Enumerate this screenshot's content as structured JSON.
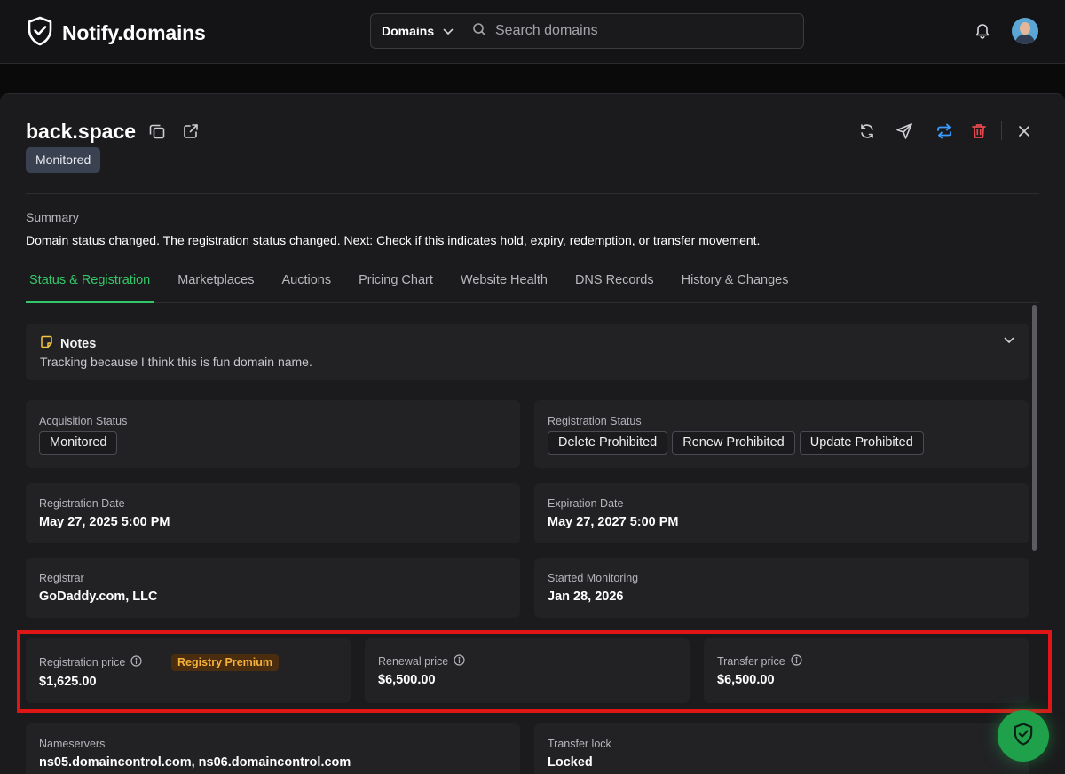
{
  "app": {
    "name": "Notify.domains"
  },
  "search": {
    "scope": "Domains",
    "placeholder": "Search domains"
  },
  "domain": {
    "name": "back.space",
    "status": "Monitored",
    "summary_label": "Summary",
    "summary_text": "Domain status changed. The registration status changed. Next: Check if this indicates hold, expiry, redemption, or transfer movement."
  },
  "tabs": [
    {
      "label": "Status & Registration",
      "active": true
    },
    {
      "label": "Marketplaces"
    },
    {
      "label": "Auctions"
    },
    {
      "label": "Pricing Chart"
    },
    {
      "label": "Website Health"
    },
    {
      "label": "DNS Records"
    },
    {
      "label": "History & Changes"
    }
  ],
  "notes": {
    "title": "Notes",
    "text": "Tracking because I think this is fun domain name."
  },
  "fields": {
    "acquisition_status": {
      "label": "Acquisition Status",
      "value": "Monitored"
    },
    "registration_status": {
      "label": "Registration Status",
      "values": [
        "Delete Prohibited",
        "Renew Prohibited",
        "Update Prohibited"
      ]
    },
    "registration_date": {
      "label": "Registration Date",
      "value": "May 27, 2025 5:00 PM"
    },
    "expiration_date": {
      "label": "Expiration Date",
      "value": "May 27, 2027 5:00 PM"
    },
    "registrar": {
      "label": "Registrar",
      "value": "GoDaddy.com, LLC"
    },
    "started_monitoring": {
      "label": "Started Monitoring",
      "value": "Jan 28, 2026"
    },
    "registration_price": {
      "label": "Registration price",
      "badge": "Registry Premium",
      "value": "$1,625.00"
    },
    "renewal_price": {
      "label": "Renewal price",
      "value": "$6,500.00"
    },
    "transfer_price": {
      "label": "Transfer price",
      "value": "$6,500.00"
    },
    "nameservers": {
      "label": "Nameservers",
      "value": "ns05.domaincontrol.com, ns06.domaincontrol.com"
    },
    "transfer_lock": {
      "label": "Transfer lock",
      "value": "Locked"
    }
  },
  "colors": {
    "accent": "#34c76a",
    "premium_text": "#f6b13b",
    "premium_bg": "#4a2d0e",
    "delete": "#e5484d",
    "transfer_icon": "#3b9dff",
    "highlight": "#e01616"
  },
  "icons": [
    "shield-check-icon",
    "chevron-down-icon",
    "search-icon",
    "bell-icon",
    "copy-icon",
    "external-link-icon",
    "refresh-icon",
    "send-icon",
    "transfer-icon",
    "trash-icon",
    "close-icon",
    "note-icon",
    "info-icon"
  ]
}
